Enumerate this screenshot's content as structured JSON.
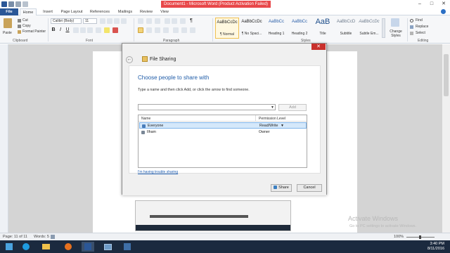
{
  "titlebar": {
    "document_title": "Document1 - Microsoft Word (Product Activation Failed)",
    "colors": {
      "title_badge": "#e8484a"
    }
  },
  "ribbon": {
    "tabs": [
      "File",
      "Home",
      "Insert",
      "Page Layout",
      "References",
      "Mailings",
      "Review",
      "View"
    ],
    "clipboard": {
      "paste": "Paste",
      "cut": "Cut",
      "copy": "Copy",
      "format_painter": "Format Painter",
      "label": "Clipboard"
    },
    "font": {
      "font_name": "Calibri (Body)",
      "font_size": "11",
      "label": "Font"
    },
    "paragraph": {
      "label": "Paragraph"
    },
    "styles": {
      "items": [
        {
          "sample": "AaBbCcDc",
          "name": "¶ Normal"
        },
        {
          "sample": "AaBbCcDc",
          "name": "¶ No Spaci..."
        },
        {
          "sample": "AaBbCc",
          "name": "Heading 1"
        },
        {
          "sample": "AaBbCc",
          "name": "Heading 2"
        },
        {
          "sample": "AaB",
          "name": "Title"
        },
        {
          "sample": "AaBbCcD",
          "name": "Subtitle"
        },
        {
          "sample": "AaBbCcDc",
          "name": "Subtle Em..."
        }
      ],
      "change_styles": "Change Styles",
      "label": "Styles"
    },
    "editing": {
      "find": "Find",
      "replace": "Replace",
      "select": "Select",
      "label": "Editing"
    }
  },
  "status": {
    "page": "Page: 11 of 11",
    "words": "Words: 5",
    "zoom": "100%"
  },
  "watermark": {
    "line1": "Activate Windows",
    "line2": "Go to PC settings to activate Windows."
  },
  "taskbar": {
    "time": "3:40 PM",
    "date": "8/11/2016"
  },
  "dialog": {
    "title": "File Sharing",
    "heading": "Choose people to share with",
    "instruction": "Type a name and then click Add, or click the arrow to find someone.",
    "add_label": "Add",
    "columns": {
      "name": "Name",
      "permission": "Permission Level"
    },
    "rows": [
      {
        "name": "Everyone",
        "permission": "Read/Write"
      },
      {
        "name": "Ilham",
        "permission": "Owner"
      }
    ],
    "trouble_link": "I'm having trouble sharing",
    "share_label": "Share",
    "cancel_label": "Cancel",
    "colors": {
      "heading": "#1f5ca8",
      "selected_row": "#d5e8fa",
      "close": "#c9302c"
    }
  }
}
